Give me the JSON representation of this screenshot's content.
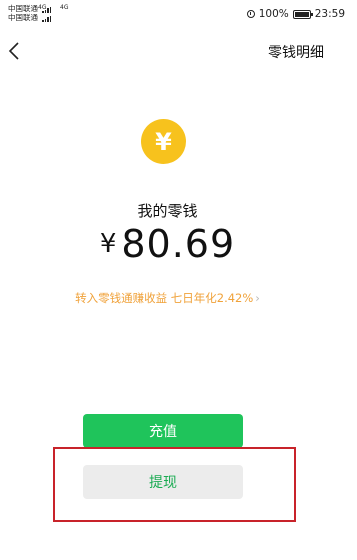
{
  "status_bar": {
    "carrier_1": "中国联通",
    "carrier_2": "中国联通",
    "network_1": "4G",
    "network_2": "4G",
    "battery_percent": "100%",
    "time": "23:59"
  },
  "navbar": {
    "title": "零钱明细"
  },
  "wallet": {
    "label": "我的零钱",
    "currency_symbol": "¥",
    "balance": "80.69",
    "promo_text": "转入零钱通赚收益 七日年化2.42%",
    "promo_chevron": "›"
  },
  "actions": {
    "top_up_label": "充值",
    "withdraw_label": "提现"
  },
  "colors": {
    "coin": "#f7c21d",
    "primary_green": "#1fc45b",
    "withdraw_text": "#1aab52",
    "promo_orange": "#f0a23a",
    "highlight_red": "#c8232a"
  }
}
